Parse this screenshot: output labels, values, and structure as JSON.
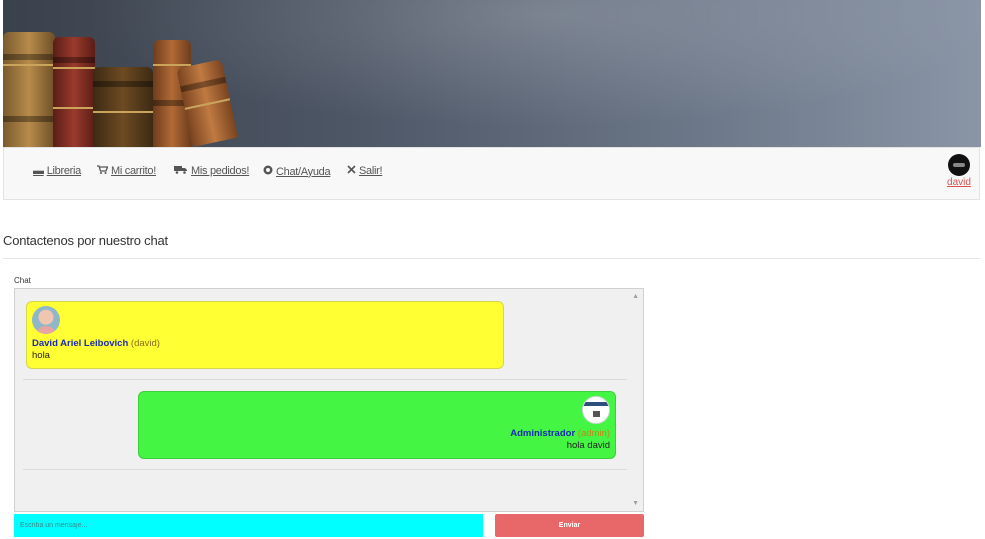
{
  "nav": {
    "items": [
      {
        "icon": "book-icon",
        "glyph": "▬",
        "label": "Libreria"
      },
      {
        "icon": "cart-icon",
        "glyph": "🛒",
        "label": "Mi carrito!"
      },
      {
        "icon": "truck-icon",
        "glyph": "⛟",
        "label": "Mis pedidos!"
      },
      {
        "icon": "chat-help-icon",
        "glyph": "⚙",
        "label": "Chat/Ayuda"
      },
      {
        "icon": "close-icon",
        "glyph": "✕",
        "label": "Salir!"
      }
    ],
    "user": {
      "name": "david"
    }
  },
  "page": {
    "title": "Contactenos por nuestro chat"
  },
  "chat": {
    "label": "Chat",
    "messages": [
      {
        "author": "David Ariel Leibovich",
        "username": "(david)",
        "text": "hola",
        "side": "left"
      },
      {
        "author": "Administrador",
        "username": "(admin)",
        "text": "hola david",
        "side": "right"
      }
    ],
    "input_placeholder": "Escriba un mensaje...",
    "send_label": "Enviar"
  },
  "colors": {
    "left_bubble": "#ffff33",
    "right_bubble": "#44f544",
    "input_bg": "#00ffff",
    "send_button": "#e8686a",
    "user_link": "#d9534f"
  }
}
